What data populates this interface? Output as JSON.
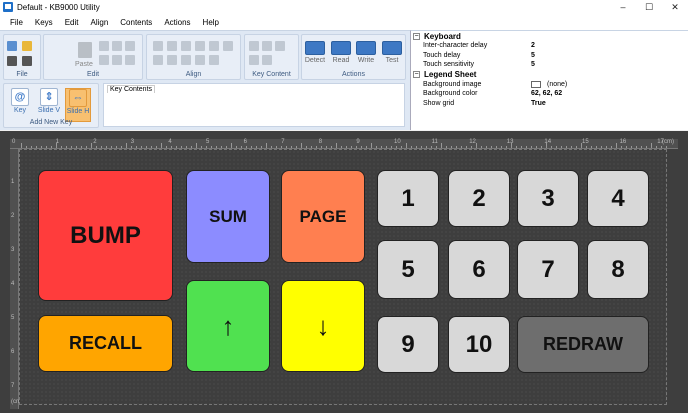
{
  "window": {
    "title": "Default - KB9000 Utility",
    "controls": {
      "minimize": "–",
      "maximize": "☐",
      "close": "✕"
    }
  },
  "menu": [
    "File",
    "Keys",
    "Edit",
    "Align",
    "Contents",
    "Actions",
    "Help"
  ],
  "ribbon": {
    "groups": {
      "file": "File",
      "edit": "Edit",
      "align": "Align",
      "key_content": "Key Content",
      "actions": "Actions",
      "add_new_key": "Add New Key"
    },
    "paste_label": "Paste",
    "actions": [
      "Detect",
      "Read",
      "Write",
      "Test"
    ],
    "add_key_buttons": [
      {
        "label": "Key",
        "symbol": "@"
      },
      {
        "label": "Slide V",
        "symbol": "⇕"
      },
      {
        "label": "Slide H",
        "symbol": "⇔"
      }
    ],
    "key_contents_tab": "Key Contents"
  },
  "properties": {
    "keyboard_section": "Keyboard",
    "keyboard_rows": [
      {
        "name": "Inter-character delay",
        "value": "2"
      },
      {
        "name": "Touch delay",
        "value": "5"
      },
      {
        "name": "Touch sensitivity",
        "value": "5"
      }
    ],
    "legend_section": "Legend Sheet",
    "legend_rows": [
      {
        "name": "Background image",
        "value": "(none)"
      },
      {
        "name": "Background color",
        "value": "62, 62, 62"
      },
      {
        "name": "Show grid",
        "value": "True"
      }
    ]
  },
  "ruler": {
    "top_numbers": [
      "1",
      "2",
      "3",
      "4",
      "5",
      "6",
      "7",
      "8",
      "9",
      "10",
      "11",
      "12",
      "13",
      "14",
      "15",
      "16",
      "17"
    ],
    "left_numbers": [
      "1",
      "2",
      "3",
      "4",
      "5",
      "6",
      "7"
    ],
    "unit": "(cm)",
    "corner": "0"
  },
  "keys": [
    {
      "label": "BUMP",
      "color": "#ff3c3c"
    },
    {
      "label": "SUM",
      "color": "#8c8cff"
    },
    {
      "label": "PAGE",
      "color": "#ff7f50"
    },
    {
      "label": "RECALL",
      "color": "#ffa500"
    },
    {
      "label": "↑",
      "color": "#50e150"
    },
    {
      "label": "↓",
      "color": "#ffff00"
    },
    {
      "label": "1",
      "color": "#d8d8d8"
    },
    {
      "label": "2",
      "color": "#d8d8d8"
    },
    {
      "label": "3",
      "color": "#d8d8d8"
    },
    {
      "label": "4",
      "color": "#d8d8d8"
    },
    {
      "label": "5",
      "color": "#d8d8d8"
    },
    {
      "label": "6",
      "color": "#d8d8d8"
    },
    {
      "label": "7",
      "color": "#d8d8d8"
    },
    {
      "label": "8",
      "color": "#d8d8d8"
    },
    {
      "label": "9",
      "color": "#d8d8d8"
    },
    {
      "label": "10",
      "color": "#d8d8d8"
    },
    {
      "label": "REDRAW",
      "color": "#6e6e6e"
    }
  ]
}
